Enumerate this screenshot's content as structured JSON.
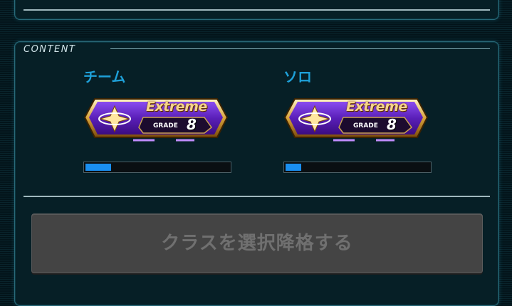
{
  "section": {
    "title": "CONTENT"
  },
  "modes": [
    {
      "label": "チーム",
      "badge": {
        "title": "Extreme",
        "grade_label": "GRADE",
        "grade": "8"
      },
      "progress": 0.18
    },
    {
      "label": "ソロ",
      "badge": {
        "title": "Extreme",
        "grade_label": "GRADE",
        "grade": "8"
      },
      "progress": 0.11
    }
  ],
  "action_button": {
    "label": "クラスを選択降格する"
  },
  "footer_text": "",
  "colors": {
    "accent": "#1ea0d8",
    "badge_purple": "#6a2bd0",
    "badge_gold": "#f6d48a",
    "progress_fill": "#1a8ff0",
    "button_bg": "#444444"
  }
}
